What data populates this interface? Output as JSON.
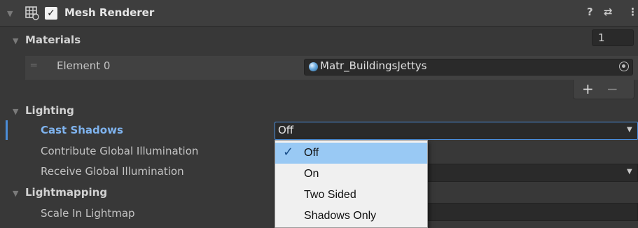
{
  "component": {
    "title": "Mesh Renderer",
    "enabled_mark": "✓",
    "help_icon": "?",
    "presets_icon": "⇄",
    "menu_icon": "⋮"
  },
  "materials": {
    "label": "Materials",
    "count": "1",
    "element_label": "Element 0",
    "element_value": "Matr_BuildingsJettys",
    "add_label": "+",
    "remove_label": "−"
  },
  "lighting": {
    "label": "Lighting",
    "cast_shadows_label": "Cast Shadows",
    "cast_shadows_value": "Off",
    "contribute_gi_label": "Contribute Global Illumination",
    "receive_gi_label": "Receive Global Illumination"
  },
  "lightmapping": {
    "label": "Lightmapping",
    "scale_label": "Scale In Lightmap"
  },
  "dropdown": {
    "check_mark": "✓",
    "options": [
      "Off",
      "On",
      "Two Sided",
      "Shadows Only"
    ],
    "selected_index": 0
  }
}
